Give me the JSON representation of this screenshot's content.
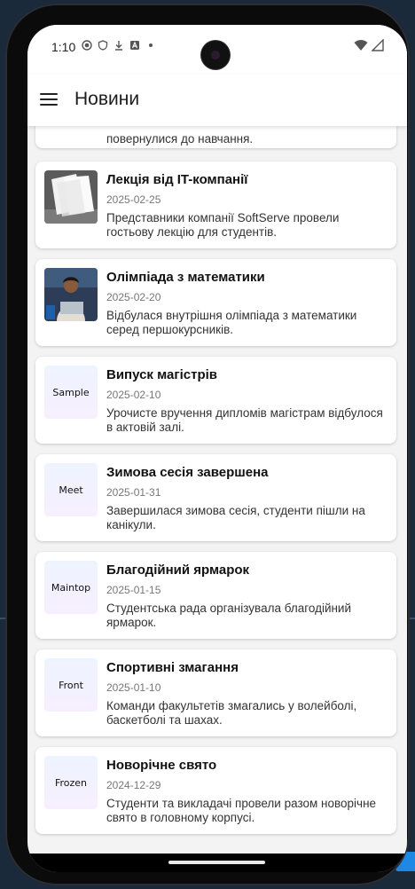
{
  "status_bar": {
    "time": "1:10",
    "left_icons": [
      "record-icon",
      "shield-icon",
      "download-icon",
      "font-icon",
      "dot-icon"
    ],
    "right_icons": [
      "wifi-icon",
      "signal-icon"
    ]
  },
  "app_bar": {
    "title": "Новини"
  },
  "partial_item": {
    "description": "повернулися до навчання."
  },
  "news": [
    {
      "title": "Лекція від IT-компанії",
      "date": "2025-02-25",
      "description": "Представники компанії SoftServe провели гостьову лекцію для студентів.",
      "thumb": "papers-photo",
      "thumb_label": ""
    },
    {
      "title": "Олімпіада з математики",
      "date": "2025-02-20",
      "description": "Відбулася внутрішня олімпіада з математики серед першокурсників.",
      "thumb": "student-laptop-photo",
      "thumb_label": ""
    },
    {
      "title": "Випуск магістрів",
      "date": "2025-02-10",
      "description": "Урочисте вручення дипломів магістрам відбулося в актовій залі.",
      "thumb": "placeholder",
      "thumb_label": "Sample"
    },
    {
      "title": "Зимова сесія завершена",
      "date": "2025-01-31",
      "description": "Завершилася зимова сесія, студенти пішли на канікули.",
      "thumb": "placeholder",
      "thumb_label": "Meet"
    },
    {
      "title": "Благодійний ярмарок",
      "date": "2025-01-15",
      "description": "Студентська рада організувала благодійний ярмарок.",
      "thumb": "placeholder",
      "thumb_label": "Maintop"
    },
    {
      "title": "Спортивні змагання",
      "date": "2025-01-10",
      "description": "Команди факультетів змагались у волейболі, баскетболі та шахах.",
      "thumb": "placeholder",
      "thumb_label": "Front"
    },
    {
      "title": "Новорічне свято",
      "date": "2024-12-29",
      "description": "Студенти та викладачі провели разом новорічне свято в головному корпусі.",
      "thumb": "placeholder",
      "thumb_label": "Frozen"
    }
  ]
}
